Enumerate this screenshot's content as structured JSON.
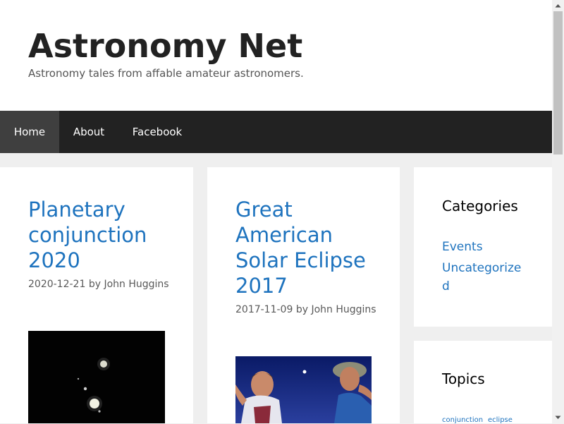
{
  "site": {
    "title": "Astronomy Net",
    "description": "Astronomy tales from affable amateur astronomers."
  },
  "nav": {
    "items": [
      {
        "label": "Home",
        "active": true
      },
      {
        "label": "About",
        "active": false
      },
      {
        "label": "Facebook",
        "active": false
      }
    ]
  },
  "posts": [
    {
      "title": "Planetary conjunction 2020",
      "date": "2020-12-21",
      "by": "by",
      "author": "John Huggins"
    },
    {
      "title": "Great American Solar Eclipse 2017",
      "date": "2017-11-09",
      "by": "by",
      "author": "John Huggins"
    }
  ],
  "sidebar": {
    "categories": {
      "title": "Categories",
      "items": [
        "Events",
        "Uncategorized"
      ]
    },
    "topics": {
      "title": "Topics",
      "tags": [
        "conjunction",
        "eclipse"
      ]
    }
  },
  "colors": {
    "link": "#1e73be",
    "nav_bg": "#222222",
    "nav_active": "#3f3f3f",
    "page_bg": "#efefef"
  }
}
